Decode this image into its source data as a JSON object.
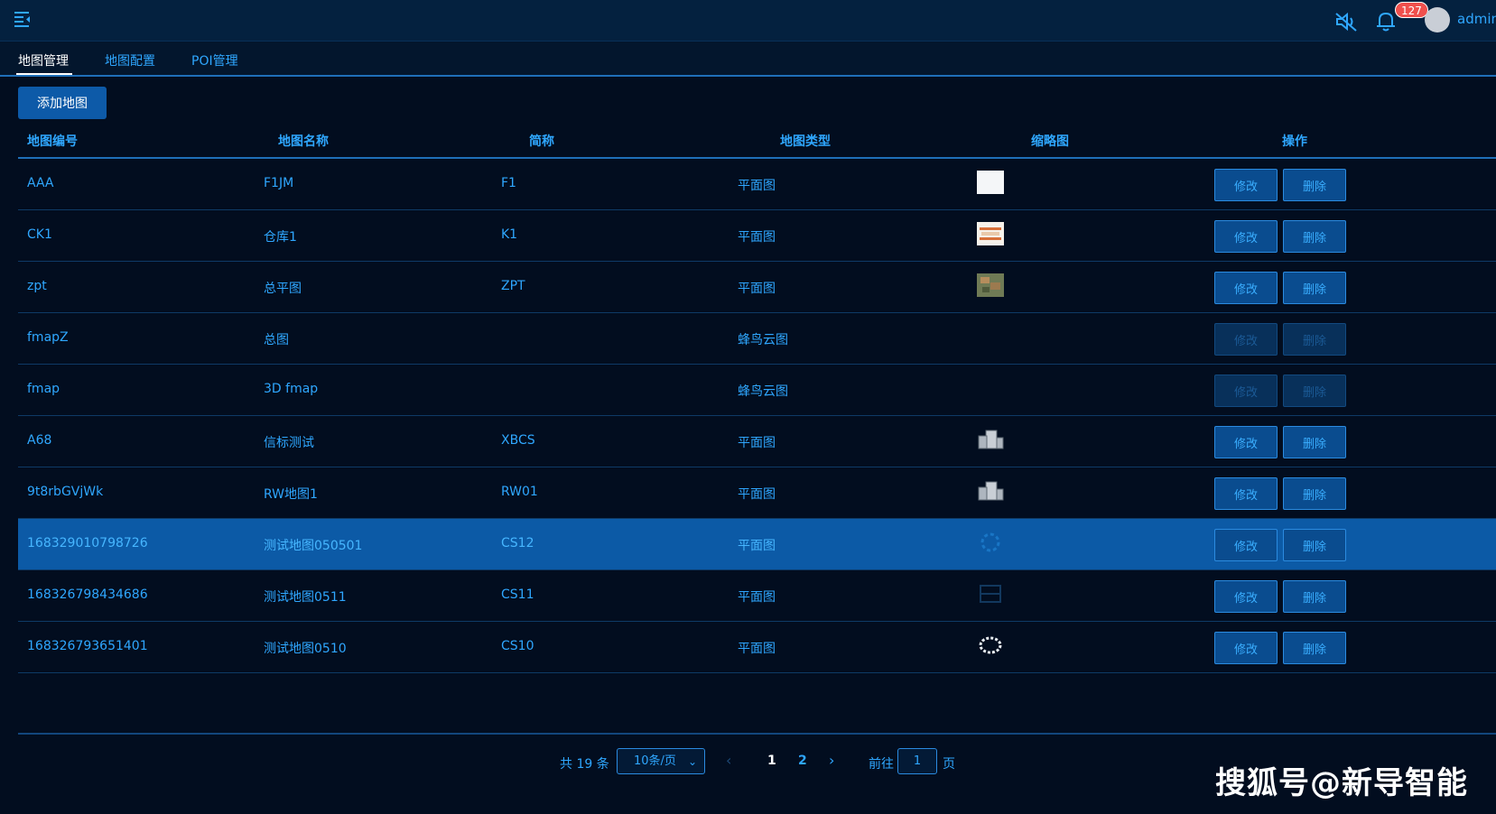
{
  "topbar": {
    "badge_count": "127",
    "username": "admin"
  },
  "tabs": [
    {
      "label": "地图管理",
      "active": true
    },
    {
      "label": "地图配置",
      "active": false
    },
    {
      "label": "POI管理",
      "active": false
    }
  ],
  "toolbar": {
    "add_label": "添加地图"
  },
  "table": {
    "headers": [
      "地图编号",
      "地图名称",
      "简称",
      "地图类型",
      "缩略图",
      "操作"
    ],
    "rows": [
      {
        "id": "AAA",
        "name": "F1JM",
        "short": "F1",
        "type": "平面图",
        "thumb": "white",
        "enabled": true,
        "selected": false
      },
      {
        "id": "CK1",
        "name": "仓库1",
        "short": "K1",
        "type": "平面图",
        "thumb": "warehouse",
        "enabled": true,
        "selected": false
      },
      {
        "id": "zpt",
        "name": "总平图",
        "short": "ZPT",
        "type": "平面图",
        "thumb": "aerial",
        "enabled": true,
        "selected": false
      },
      {
        "id": "fmapZ",
        "name": "总图",
        "short": "",
        "type": "蜂鸟云图",
        "thumb": "none",
        "enabled": false,
        "selected": false
      },
      {
        "id": "fmap",
        "name": "3D fmap",
        "short": "",
        "type": "蜂鸟云图",
        "thumb": "none",
        "enabled": false,
        "selected": false
      },
      {
        "id": "A68",
        "name": "信标测试",
        "short": "XBCS",
        "type": "平面图",
        "thumb": "building",
        "enabled": true,
        "selected": false
      },
      {
        "id": "9t8rbGVjWk",
        "name": "RW地图1",
        "short": "RW01",
        "type": "平面图",
        "thumb": "building",
        "enabled": true,
        "selected": false
      },
      {
        "id": "168329010798726",
        "name": "测试地图050501",
        "short": "CS12",
        "type": "平面图",
        "thumb": "faint-ring",
        "enabled": true,
        "selected": true
      },
      {
        "id": "168326798434686",
        "name": "测试地图0511",
        "short": "CS11",
        "type": "平面图",
        "thumb": "faint-plan",
        "enabled": true,
        "selected": false
      },
      {
        "id": "168326793651401",
        "name": "测试地图0510",
        "short": "CS10",
        "type": "平面图",
        "thumb": "ring",
        "enabled": true,
        "selected": false
      }
    ],
    "edit_label": "修改",
    "delete_label": "删除"
  },
  "pagination": {
    "total_text": "共 19 条",
    "page_size": "10条/页",
    "pages": [
      "1",
      "2"
    ],
    "current_page": "1",
    "goto_label": "前往",
    "goto_value": "1",
    "page_suffix": "页"
  },
  "watermark": "搜狐号@新导智能",
  "colors": {
    "background": "#020d1f",
    "topbar": "#04213f",
    "accent": "#2fa7ff",
    "selected_row": "#0c5aa6",
    "badge": "#f0504d"
  }
}
